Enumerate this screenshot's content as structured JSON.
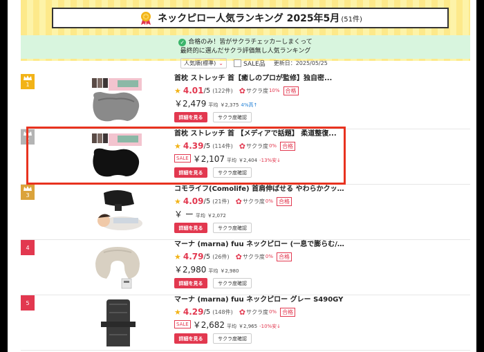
{
  "header": {
    "title": "ネックピロー人気ランキング 2025年5月",
    "count": "(51件)",
    "banner_line1": "合格のみ！皆がサクラチェッカーしまくって",
    "banner_line2": "最終的に選んだサクラ評価無し人気ランキング"
  },
  "controls": {
    "sort_label": "人気順(標準)",
    "sale_label": "SALE品",
    "updated": "更新日：2025/05/25"
  },
  "labels": {
    "detail_button": "詳細を見る",
    "sakura_button": "サクラ度確認",
    "sakura_label": "サクラ度",
    "pass_label": "合格",
    "avg_label": "平均",
    "sale_tag": "SALE",
    "outof": "/5"
  },
  "products": [
    {
      "rank": "1",
      "name": "首枕 ストレッチ 首【癒しのプロが監修】独自密...",
      "score": "4.01",
      "reviews": "(122件)",
      "sakura_pct": "10%",
      "price": "￥2,479",
      "sale": false,
      "avg_price": "￥2,375",
      "diff": "4%高↑",
      "diff_dir": "up"
    },
    {
      "rank": "2",
      "name": "首枕 ストレッチ 首 【メディアで話題】 柔道整復...",
      "score": "4.39",
      "reviews": "(114件)",
      "sakura_pct": "0%",
      "price": "￥2,107",
      "sale": true,
      "avg_price": "￥2,404",
      "diff": "-13%安↓",
      "diff_dir": "down"
    },
    {
      "rank": "3",
      "name": "コモライフ(Comolife) 首肩伸ばせる やわらかクッショ...",
      "score": "4.09",
      "reviews": "(21件)",
      "sakura_pct": "0%",
      "price": "￥ ー",
      "sale": false,
      "avg_price": "￥2,072",
      "diff": "",
      "diff_dir": ""
    },
    {
      "rank": "4",
      "name": "マーナ (marna) fuu ネックピロー (一息で膨らむ/たた...",
      "score": "4.79",
      "reviews": "(26件)",
      "sakura_pct": "0%",
      "price": "￥2,980",
      "sale": false,
      "avg_price": "￥2,980",
      "diff": "",
      "diff_dir": ""
    },
    {
      "rank": "5",
      "name": "マーナ (marna) fuu ネックピロー グレー S490GY",
      "score": "4.29",
      "reviews": "(148件)",
      "sakura_pct": "0%",
      "price": "￥2,682",
      "sale": true,
      "avg_price": "￥2,965",
      "diff": "-10%安↓",
      "diff_dir": "down"
    }
  ],
  "colors": {
    "accent": "#e2384f",
    "gold": "#f2b317",
    "highlight": "#e8321f",
    "banner": "#d8f5de"
  }
}
